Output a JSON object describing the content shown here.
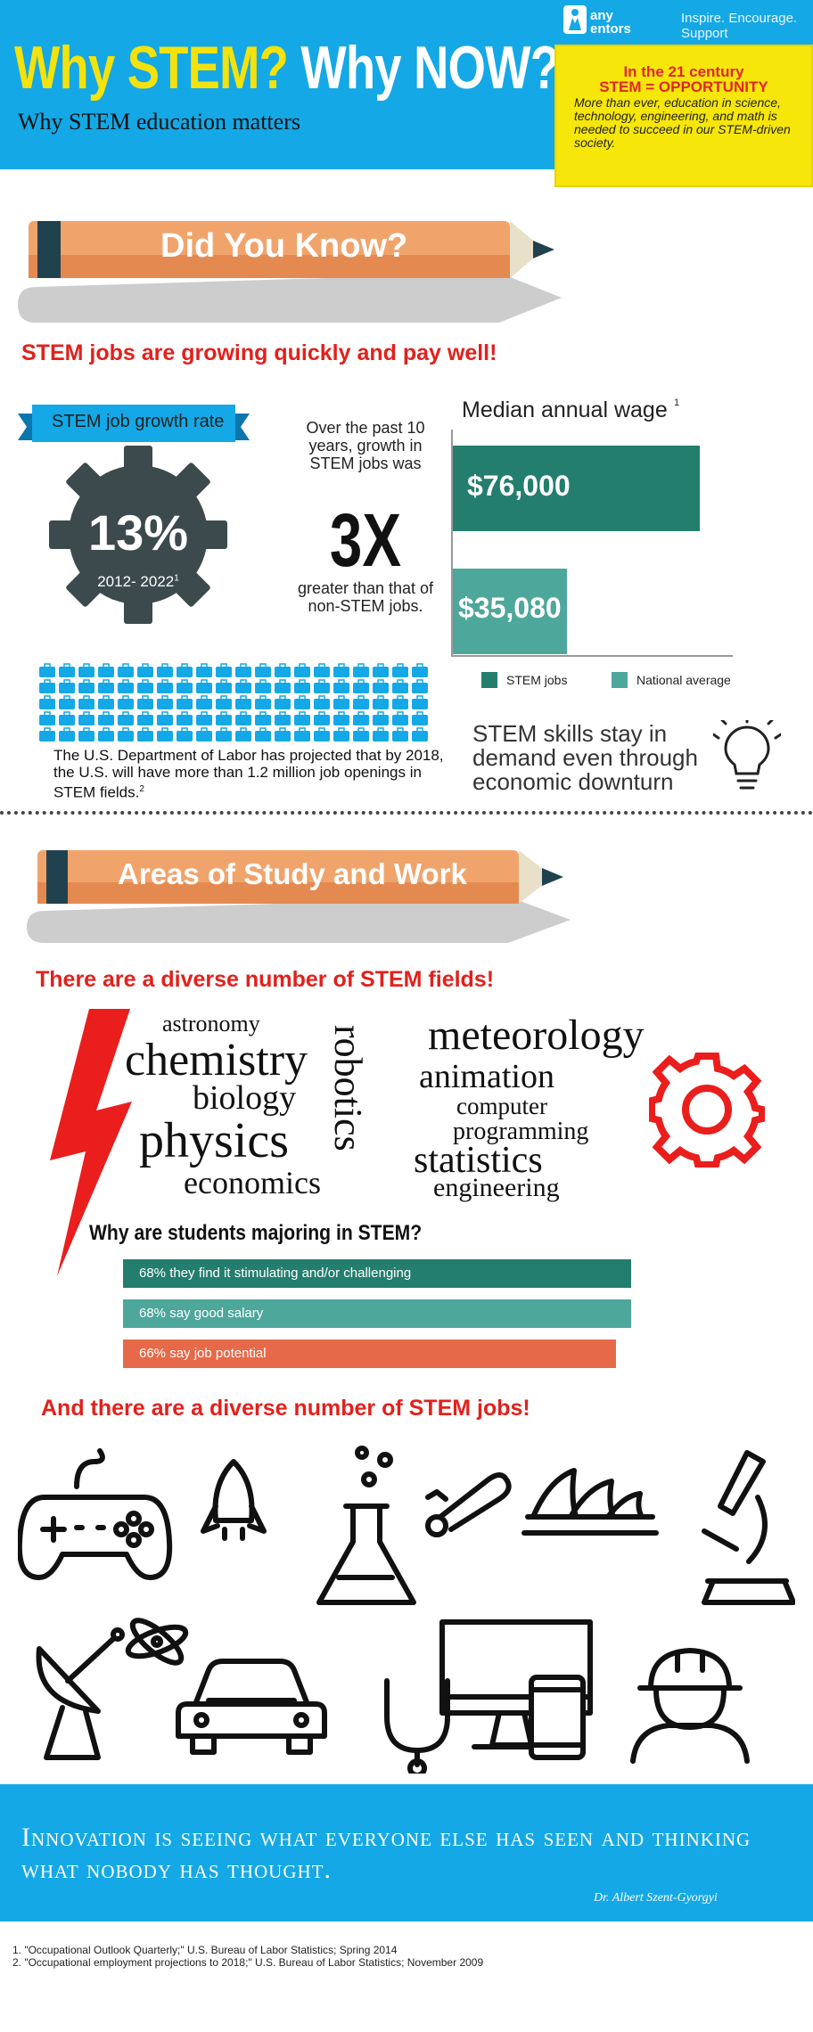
{
  "header": {
    "title_part1": "Why STEM?",
    "title_part2": "Why NOW?",
    "subtitle": "Why STEM education matters",
    "logo_line1": "any",
    "logo_line2": "entors",
    "tagline": "Inspire. Encourage. Support"
  },
  "callout": {
    "line1": "In the 21 century",
    "line2": "STEM = OPPORTUNITY",
    "body": "More than ever, education in science, technology, engineering, and math is needed to succeed in our STEM-driven society."
  },
  "section1": {
    "banner": "Did You Know?",
    "heading": "STEM jobs are growing quickly and pay well!",
    "growth_label": "STEM job growth rate",
    "growth_pct": "13%",
    "growth_years": "2012- 2022",
    "growth_sup": "1",
    "over_past": "Over the past 10 years, growth in STEM jobs was",
    "multiplier": "3X",
    "greater": "greater than that of non-STEM jobs.",
    "labor_text": "The U.S. Department of Labor has projected that by 2018, the U.S. will have more than 1.2 million job openings in STEM fields.",
    "labor_sup": "2",
    "skills_text": "STEM skills stay in demand even through economic downturn"
  },
  "wage_chart": {
    "title": "Median annual wage",
    "title_sup": "1",
    "legend": [
      "STEM jobs",
      "National average"
    ],
    "colors": [
      "#237e6e",
      "#4ea79b"
    ]
  },
  "chart_data": {
    "type": "bar",
    "orientation": "horizontal",
    "title": "Median annual wage",
    "categories": [
      "STEM jobs",
      "National average"
    ],
    "values": [
      76000,
      35080
    ],
    "value_labels": [
      "$76,000",
      "$35,080"
    ],
    "xlim": [
      0,
      80000
    ],
    "grid": false,
    "legend_position": "bottom"
  },
  "section2": {
    "banner": "Areas of Study and Work",
    "heading": "There are a diverse number of STEM fields!",
    "words": {
      "astronomy": "astronomy",
      "chemistry": "chemistry",
      "biology": "biology",
      "physics": "physics",
      "economics": "economics",
      "robotics": "robotics",
      "meteorology": "meteorology",
      "animation": "animation",
      "computer": "computer",
      "programming": "programming",
      "statistics": "statistics",
      "engineering": "engineering"
    },
    "majoring_heading": "Why are students majoring in STEM?",
    "majoring": [
      {
        "label": "68% they find it stimulating and/or challenging",
        "value": 68,
        "color": "#237e6e"
      },
      {
        "label": "68% say good salary",
        "value": 68,
        "color": "#4ea79b"
      },
      {
        "label": "66% say job potential",
        "value": 66,
        "color": "#e66a4a"
      }
    ],
    "jobs_heading": "And there are a diverse number of STEM jobs!"
  },
  "icons": [
    "game-controller-icon",
    "rocket-icon",
    "flask-icon",
    "wrench-icon",
    "opera-house-icon",
    "microscope-icon",
    "atom-icon",
    "satellite-dish-icon",
    "car-icon",
    "computer-monitor-icon",
    "stethoscope-icon",
    "engineer-hardhat-icon",
    "lightning-bolt-icon",
    "gear-icon",
    "lightbulb-icon",
    "briefcase-icon"
  ],
  "quote": {
    "text": "Innovation is seeing what everyone else has seen and thinking what nobody has thought.",
    "author": "Dr. Albert Szent-Gyorgyi"
  },
  "footnotes": [
    "1. \"Occupational Outlook Quarterly;\" U.S. Bureau of Labor Statistics; Spring 2014",
    "2. \"Occupational employment projections to 2018;\" U.S. Bureau of Labor Statistics; November 2009"
  ]
}
